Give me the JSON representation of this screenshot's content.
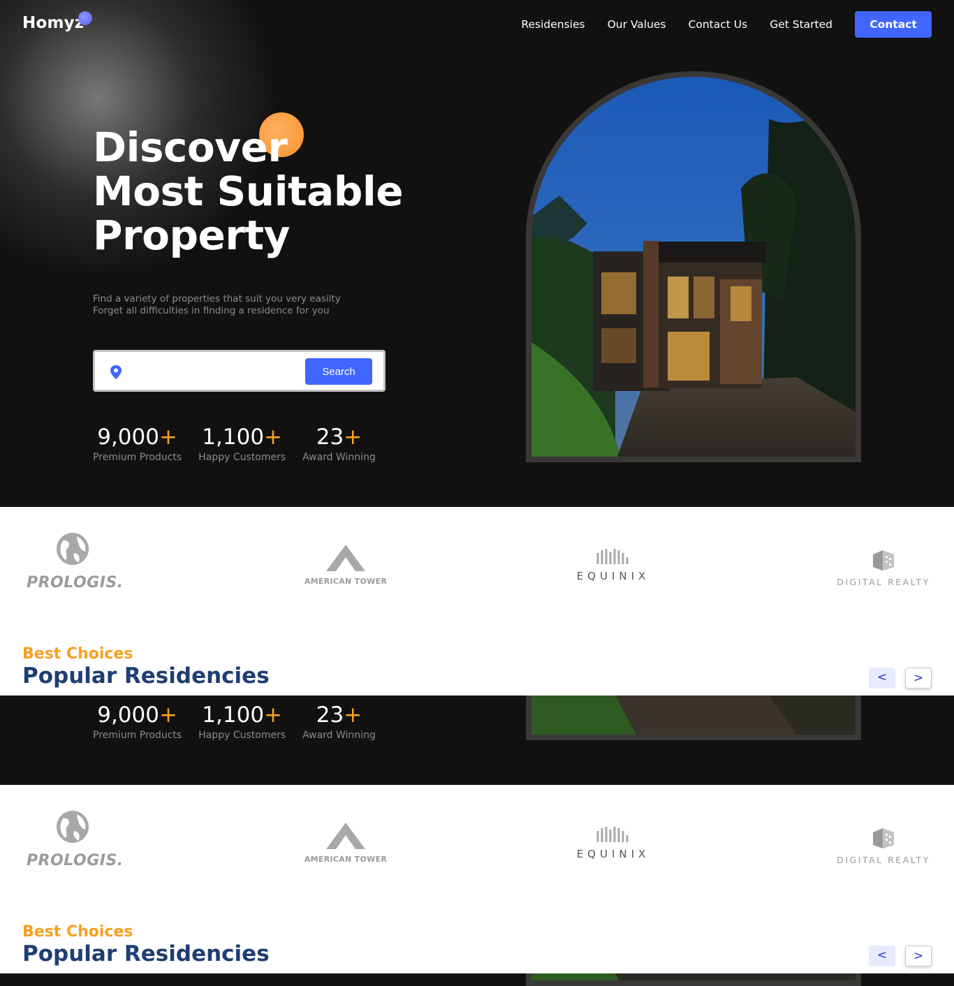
{
  "brand": {
    "name": "Homyz"
  },
  "nav": {
    "links": [
      "Residensies",
      "Our Values",
      "Contact Us",
      "Get Started"
    ],
    "contact_label": "Contact"
  },
  "hero": {
    "title_lines": [
      "Discover",
      "Most Suitable",
      "Property"
    ],
    "subtitle_lines": [
      "Find a variety of properties that suit you very easilty",
      "Forget all difficulties in finding a residence for you"
    ],
    "search": {
      "value": "",
      "button_label": "Search"
    },
    "stats": [
      {
        "value": "9,000",
        "suffix": "+",
        "label": "Premium Products"
      },
      {
        "value": "1,100",
        "suffix": "+",
        "label": "Happy Customers"
      },
      {
        "value": "23",
        "suffix": "+",
        "label": "Award Winning"
      }
    ]
  },
  "companies": [
    {
      "name": "PROLOGIS.",
      "icon": "globe-icon"
    },
    {
      "name": "AMERICAN TOWER",
      "icon": "tower-icon"
    },
    {
      "name": "EQUINIX",
      "icon": "equinix-icon"
    },
    {
      "name": "DIGITAL REALTY",
      "icon": "cube-icon"
    }
  ],
  "residencies": {
    "eyebrow": "Best Choices",
    "title": "Popular Residencies",
    "prev_label": "<",
    "next_label": ">"
  },
  "colors": {
    "accent_blue": "#4066ff",
    "accent_orange": "#f7a021",
    "heading_navy": "#1f3e72",
    "hero_bg": "#131110"
  }
}
